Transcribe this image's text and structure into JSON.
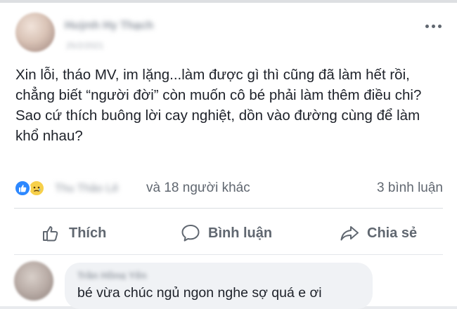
{
  "post": {
    "author_name": "Huỳnh Hy Thạch",
    "timestamp": "25/2/2021",
    "text_lines": [
      "Xin lỗi, tháo MV, im lặng...làm được gì thì cũng đã làm hết rồi, chẳng biết “người đời” còn muốn cô bé phải làm thêm điều chi?",
      "Sao cứ thích buông lời cay nghiệt, dồn vào đường cùng để làm khổ nhau?"
    ],
    "more_icon": "more-icon"
  },
  "reactions": {
    "icons": [
      "like-icon",
      "sad-icon"
    ],
    "reactor_name": "Thu Thảo Lê",
    "others_text": "và 18 người khác",
    "comment_count_text": "3 bình luận"
  },
  "actions": {
    "like_label": "Thích",
    "comment_label": "Bình luận",
    "share_label": "Chia sẻ"
  },
  "comment": {
    "author_name": "Trần Hồng Yến",
    "text": "bé vừa chúc ngủ ngon nghe sợ quá e ơi"
  },
  "colors": {
    "like_blue": "#2d88ff",
    "sad_yellow": "#f7d04a",
    "secondary_text": "#606770"
  }
}
